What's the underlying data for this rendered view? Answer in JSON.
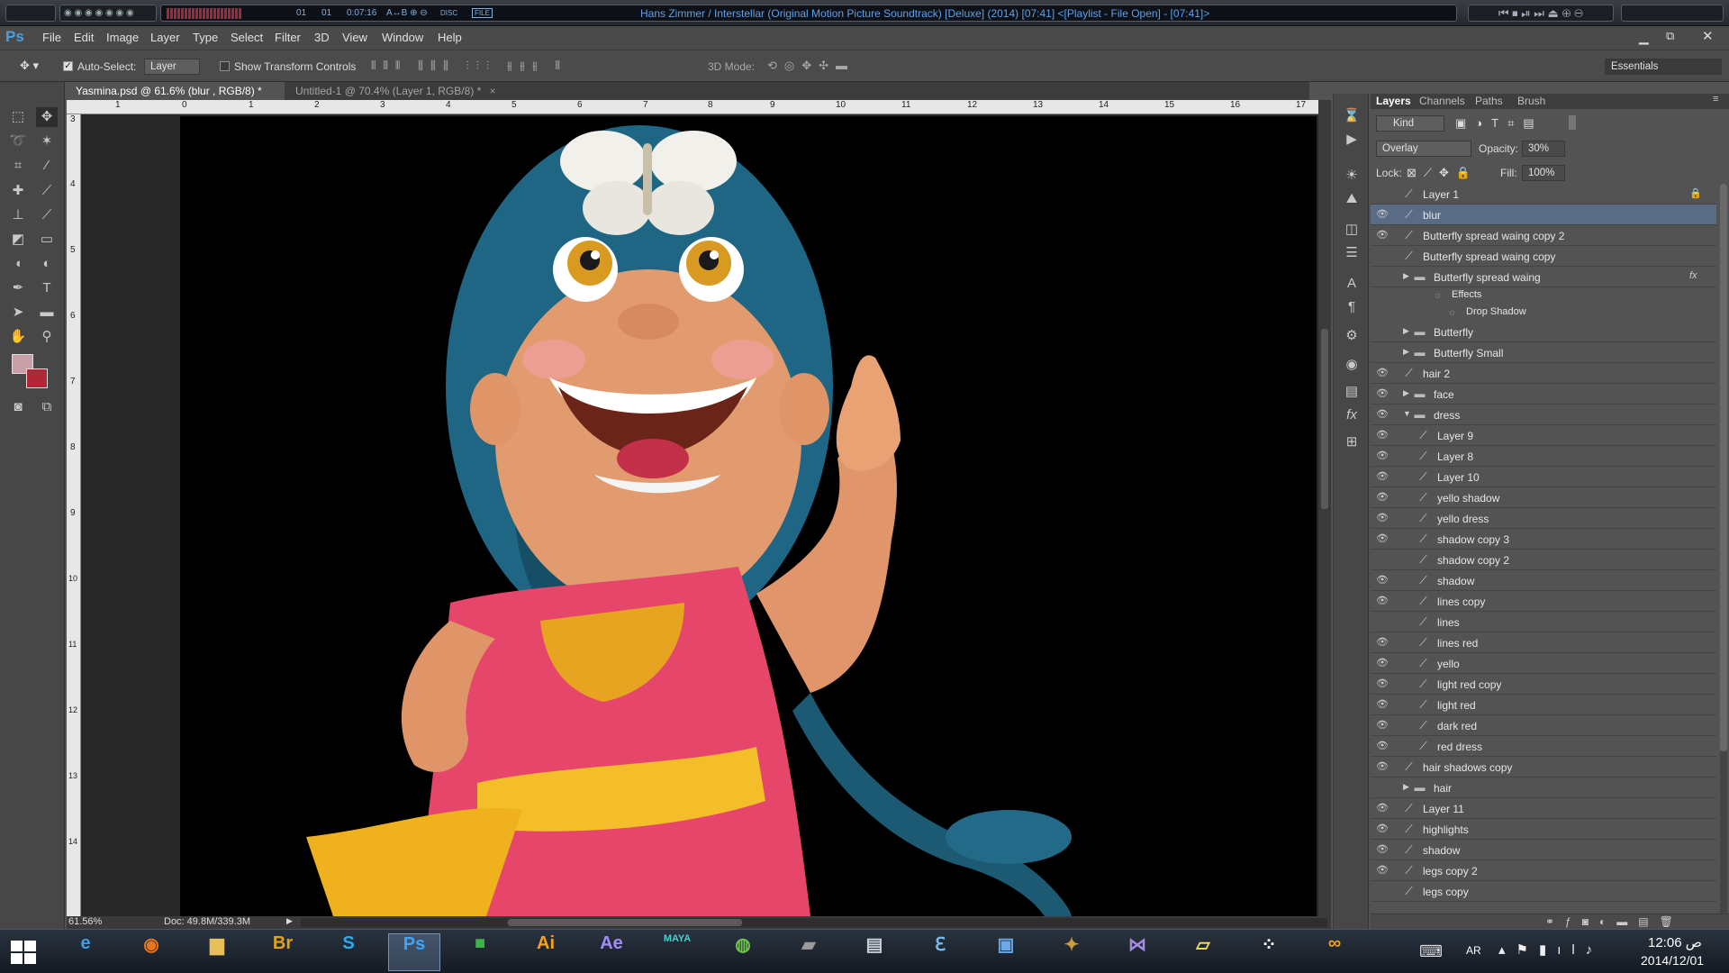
{
  "player": {
    "counter_a": "01",
    "counter_b": "01",
    "time": "0:07:16",
    "modes": "A↔B ⊕ ⊖",
    "disc": "DISC",
    "file": "FILE",
    "title": "Hans Zimmer / Interstellar (Original Motion Picture Soundtrack) [Deluxe] (2014)  [07:41]   <[Playlist - File Open] - [07:41]>"
  },
  "app": {
    "logo": "Ps"
  },
  "menu": [
    "File",
    "Edit",
    "Image",
    "Layer",
    "Type",
    "Select",
    "Filter",
    "3D",
    "View",
    "Window",
    "Help"
  ],
  "options": {
    "auto_select_label": "Auto-Select:",
    "auto_select_value": "Layer",
    "show_transform_label": "Show Transform Controls",
    "mode_3d_label": "3D Mode:",
    "workspace": "Essentials"
  },
  "doc_tabs": [
    {
      "label": "Yasmina.psd @ 61.6% (blur , RGB/8) *",
      "active": true
    },
    {
      "label": "Untitled-1 @ 70.4% (Layer 1, RGB/8) *",
      "active": false
    }
  ],
  "ruler": {
    "top": [
      "1",
      "0",
      "1",
      "2",
      "3",
      "4",
      "5",
      "6",
      "7",
      "8",
      "9",
      "10",
      "11",
      "12",
      "13",
      "14",
      "15",
      "16",
      "17"
    ],
    "left": [
      "3",
      "4",
      "5",
      "6",
      "7",
      "8",
      "9",
      "10",
      "11",
      "12",
      "13",
      "14"
    ]
  },
  "status": {
    "zoom": "61.56%",
    "doc": "Doc: 49.8M/339.3M"
  },
  "layers_panel": {
    "tabs": [
      "Layers",
      "Channels",
      "Paths",
      "Brush"
    ],
    "kind": "Kind",
    "blend_mode": "Overlay",
    "opacity_label": "Opacity:",
    "opacity": "30%",
    "lock_label": "Lock:",
    "fill_label": "Fill:",
    "fill": "100%",
    "layers": [
      {
        "name": "Layer 1",
        "indent": 0,
        "type": "paint",
        "visible": false,
        "locked": true
      },
      {
        "name": "blur",
        "indent": 0,
        "type": "paint",
        "visible": true,
        "selected": true
      },
      {
        "name": "Butterfly spread waing copy 2",
        "indent": 0,
        "type": "paint",
        "visible": true
      },
      {
        "name": "Butterfly spread waing copy",
        "indent": 0,
        "type": "paint",
        "visible": false
      },
      {
        "name": "Butterfly spread waing",
        "indent": 0,
        "type": "group",
        "visible": false,
        "fx": true
      },
      {
        "name": "Effects",
        "indent": 2,
        "type": "effect",
        "visible": false,
        "small": true
      },
      {
        "name": "Drop Shadow",
        "indent": 3,
        "type": "effect",
        "visible": false,
        "small": true
      },
      {
        "name": "Butterfly",
        "indent": 0,
        "type": "group",
        "visible": false
      },
      {
        "name": "Butterfly Small",
        "indent": 0,
        "type": "group",
        "visible": false
      },
      {
        "name": "hair 2",
        "indent": 0,
        "type": "paint",
        "visible": true
      },
      {
        "name": "face",
        "indent": 0,
        "type": "group",
        "visible": true
      },
      {
        "name": "dress",
        "indent": 0,
        "type": "group-open",
        "visible": true
      },
      {
        "name": "Layer 9",
        "indent": 1,
        "type": "paint",
        "visible": true
      },
      {
        "name": "Layer 8",
        "indent": 1,
        "type": "paint",
        "visible": true
      },
      {
        "name": "Layer 10",
        "indent": 1,
        "type": "paint",
        "visible": true
      },
      {
        "name": "yello shadow",
        "indent": 1,
        "type": "paint",
        "visible": true
      },
      {
        "name": "yello dress",
        "indent": 1,
        "type": "paint",
        "visible": true
      },
      {
        "name": "shadow copy 3",
        "indent": 1,
        "type": "paint",
        "visible": true
      },
      {
        "name": "shadow copy 2",
        "indent": 1,
        "type": "paint",
        "visible": false
      },
      {
        "name": "shadow",
        "indent": 1,
        "type": "paint",
        "visible": true
      },
      {
        "name": "lines copy",
        "indent": 1,
        "type": "paint",
        "visible": true
      },
      {
        "name": "lines",
        "indent": 1,
        "type": "paint",
        "visible": false
      },
      {
        "name": "lines red",
        "indent": 1,
        "type": "paint",
        "visible": true
      },
      {
        "name": "yello",
        "indent": 1,
        "type": "paint",
        "visible": true
      },
      {
        "name": "light red copy",
        "indent": 1,
        "type": "paint",
        "visible": true
      },
      {
        "name": "light red",
        "indent": 1,
        "type": "paint",
        "visible": true
      },
      {
        "name": "dark red",
        "indent": 1,
        "type": "paint",
        "visible": true
      },
      {
        "name": "red dress",
        "indent": 1,
        "type": "paint",
        "visible": true
      },
      {
        "name": "hair shadows copy",
        "indent": 0,
        "type": "paint",
        "visible": true
      },
      {
        "name": "hair",
        "indent": 0,
        "type": "group",
        "visible": false
      },
      {
        "name": "Layer 11",
        "indent": 0,
        "type": "paint",
        "visible": true
      },
      {
        "name": "highlights",
        "indent": 0,
        "type": "paint",
        "visible": true
      },
      {
        "name": "shadow",
        "indent": 0,
        "type": "paint",
        "visible": true
      },
      {
        "name": "legs copy 2",
        "indent": 0,
        "type": "paint",
        "visible": true
      },
      {
        "name": "legs copy",
        "indent": 0,
        "type": "paint",
        "visible": false
      }
    ]
  },
  "taskbar": {
    "apps": [
      {
        "name": "ie",
        "label": "e",
        "color": "#3a9fe8"
      },
      {
        "name": "firefox",
        "label": "◉",
        "color": "#e8741c"
      },
      {
        "name": "explorer",
        "label": "▆",
        "color": "#e8c05a"
      },
      {
        "name": "bridge",
        "label": "Br",
        "color": "#e0a21a"
      },
      {
        "name": "skype",
        "label": "S",
        "color": "#2aaef0"
      },
      {
        "name": "photoshop",
        "label": "Ps",
        "color": "#3ea5f5"
      },
      {
        "name": "camtasia",
        "label": "■",
        "color": "#3cb54a"
      },
      {
        "name": "illustrator",
        "label": "Ai",
        "color": "#f7a21a"
      },
      {
        "name": "after-effects",
        "label": "Ae",
        "color": "#a28cf7"
      },
      {
        "name": "maya",
        "label": "MAYA",
        "color": "#4dd0c8"
      },
      {
        "name": "globe",
        "label": "◍",
        "color": "#6ec44c"
      },
      {
        "name": "device",
        "label": "▰",
        "color": "#9a9a9a"
      },
      {
        "name": "monitor",
        "label": "▤",
        "color": "#c8d0d8"
      },
      {
        "name": "cleaner",
        "label": "ℇ",
        "color": "#7ab8e8"
      },
      {
        "name": "network",
        "label": "▣",
        "color": "#6aa8e8"
      },
      {
        "name": "shield-app",
        "label": "✦",
        "color": "#c9a03a"
      },
      {
        "name": "visual-studio",
        "label": "⋈",
        "color": "#a58be0"
      },
      {
        "name": "notes",
        "label": "▱",
        "color": "#f0e060"
      },
      {
        "name": "blackberry",
        "label": "⁘",
        "color": "#ffffff"
      },
      {
        "name": "link-app",
        "label": "∞",
        "color": "#f0a020"
      }
    ],
    "lang": "AR",
    "time": "12:06 ص",
    "date": "2014/12/01"
  }
}
